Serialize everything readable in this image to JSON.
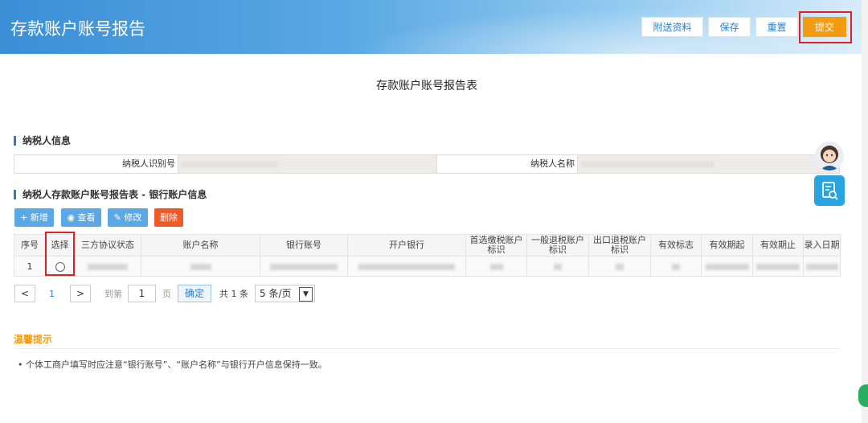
{
  "header": {
    "title": "存款账户账号报告",
    "buttons": {
      "attach": "附送资料",
      "save": "保存",
      "reset": "重置",
      "submit": "提交"
    }
  },
  "page_title": "存款账户账号报告表",
  "taxpayer_section": {
    "title": "纳税人信息",
    "id_label": "纳税人识别号",
    "name_label": "纳税人名称"
  },
  "bank_section": {
    "title": "纳税人存款账户账号报告表 - 银行账户信息",
    "toolbar": {
      "add": "+ 新增",
      "view": "查看",
      "edit": "修改",
      "delete": "删除"
    },
    "columns": [
      "序号",
      "选择",
      "三方协议状态",
      "账户名称",
      "银行账号",
      "开户银行",
      "首选缴税账户标识",
      "一般退税账户标识",
      "出口退税账户标识",
      "有效标志",
      "有效期起",
      "有效期止",
      "录入日期"
    ],
    "rows": [
      {
        "index": "1"
      }
    ]
  },
  "pager": {
    "prev": "<",
    "current_page": "1",
    "next": ">",
    "goto_label": "到第",
    "page_input": "1",
    "page_unit": "页",
    "confirm": "确定",
    "total": "共 1 条",
    "page_size": "5 条/页"
  },
  "tips": {
    "title": "温馨提示",
    "text": "• 个体工商户填写时应注意“银行账号”、“账户名称”与银行开户信息保持一致。"
  },
  "colors": {
    "accent": "#2c7fc7",
    "submit": "#f39c12",
    "highlight": "#e02020",
    "delete": "#f05a28",
    "toolbar": "#5ba8e6"
  }
}
